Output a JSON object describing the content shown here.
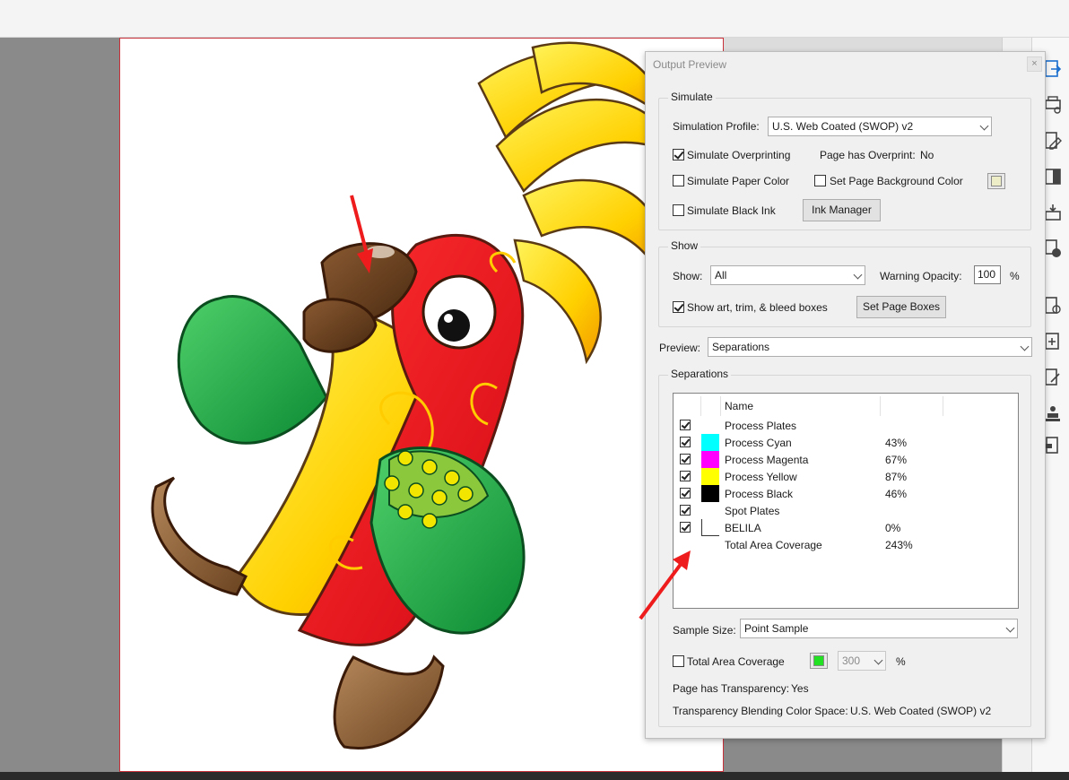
{
  "dialog": {
    "title": "Output Preview",
    "close_glyph": "×",
    "simulate": {
      "label": "Simulate",
      "profile_label": "Simulation Profile:",
      "profile_value": "U.S. Web Coated (SWOP) v2",
      "overprinting_label": "Simulate Overprinting",
      "overprinting_checked": true,
      "page_overprint_label": "Page has Overprint:",
      "page_overprint_value": "No",
      "paper_color_label": "Simulate Paper Color",
      "paper_color_checked": false,
      "bg_color_label": "Set Page Background Color",
      "bg_color_checked": false,
      "bg_swatch_color": "#ededc8",
      "black_ink_label": "Simulate Black Ink",
      "black_ink_checked": false,
      "ink_manager_label": "Ink Manager"
    },
    "show": {
      "label": "Show",
      "show_label": "Show:",
      "show_value": "All",
      "warning_opacity_label": "Warning Opacity:",
      "warning_opacity_value": "100",
      "percent": "%",
      "boxes_label": "Show art, trim, & bleed boxes",
      "boxes_checked": true,
      "set_page_boxes_label": "Set Page Boxes"
    },
    "preview": {
      "label": "Preview:",
      "value": "Separations"
    },
    "separations": {
      "label": "Separations",
      "column_name": "Name",
      "rows": [
        {
          "name": "Process Plates",
          "pct": "",
          "color": "",
          "checked": true
        },
        {
          "name": "Process Cyan",
          "pct": "43%",
          "color": "#00ffff",
          "checked": true
        },
        {
          "name": "Process Magenta",
          "pct": "67%",
          "color": "#ff00ff",
          "checked": true
        },
        {
          "name": "Process Yellow",
          "pct": "87%",
          "color": "#ffff00",
          "checked": true
        },
        {
          "name": "Process Black",
          "pct": "46%",
          "color": "#000000",
          "checked": true
        },
        {
          "name": "Spot Plates",
          "pct": "",
          "color": "",
          "checked": true
        },
        {
          "name": "BELILA",
          "pct": "0%",
          "color": "#ffffff",
          "checked": true
        },
        {
          "name": "Total Area Coverage",
          "pct": "243%",
          "color": "",
          "checked": false
        }
      ],
      "sample_size_label": "Sample Size:",
      "sample_size_value": "Point Sample",
      "tac_label": "Total Area Coverage",
      "tac_checked": false,
      "tac_color": "#22e022",
      "tac_value": "300",
      "tac_percent": "%",
      "transparency_label": "Page has Transparency:",
      "transparency_value": "Yes",
      "blend_space_label": "Transparency Blending Color Space:",
      "blend_space_value": "U.S. Web Coated (SWOP) v2"
    }
  },
  "artwork": {
    "description_icon": "parrot-illustration",
    "annotation_color": "#ee1c1c"
  },
  "rail_icons": [
    "export-pdf-icon",
    "print-production-icon",
    "edit-pdf-icon",
    "compare-icon",
    "fill-sign-icon",
    "redact-icon",
    "create-pdf-icon",
    "combine-icon",
    "request-signature-icon",
    "stamp-icon",
    "protect-icon"
  ]
}
